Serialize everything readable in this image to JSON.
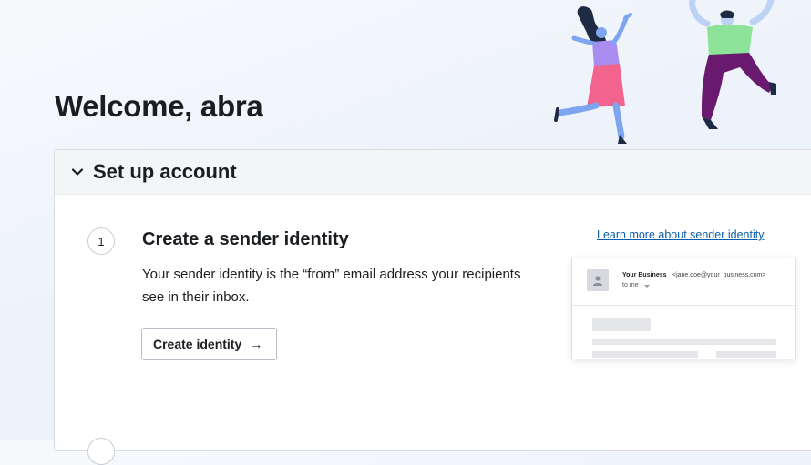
{
  "page": {
    "welcome": "Welcome, abra"
  },
  "setup": {
    "title": "Set up account",
    "step": {
      "number": "1",
      "title": "Create a sender identity",
      "description": "Your sender identity is the “from” email address your recipients see in their inbox.",
      "button_label": "Create identity",
      "button_icon": "→",
      "learn_more": "Learn more about sender identity",
      "preview": {
        "sender_name": "Your Business",
        "sender_email": "<jane.doe@your_business.com>",
        "to": "to me"
      }
    }
  },
  "colors": {
    "link": "#0b5cad",
    "text": "#1a1d21"
  }
}
